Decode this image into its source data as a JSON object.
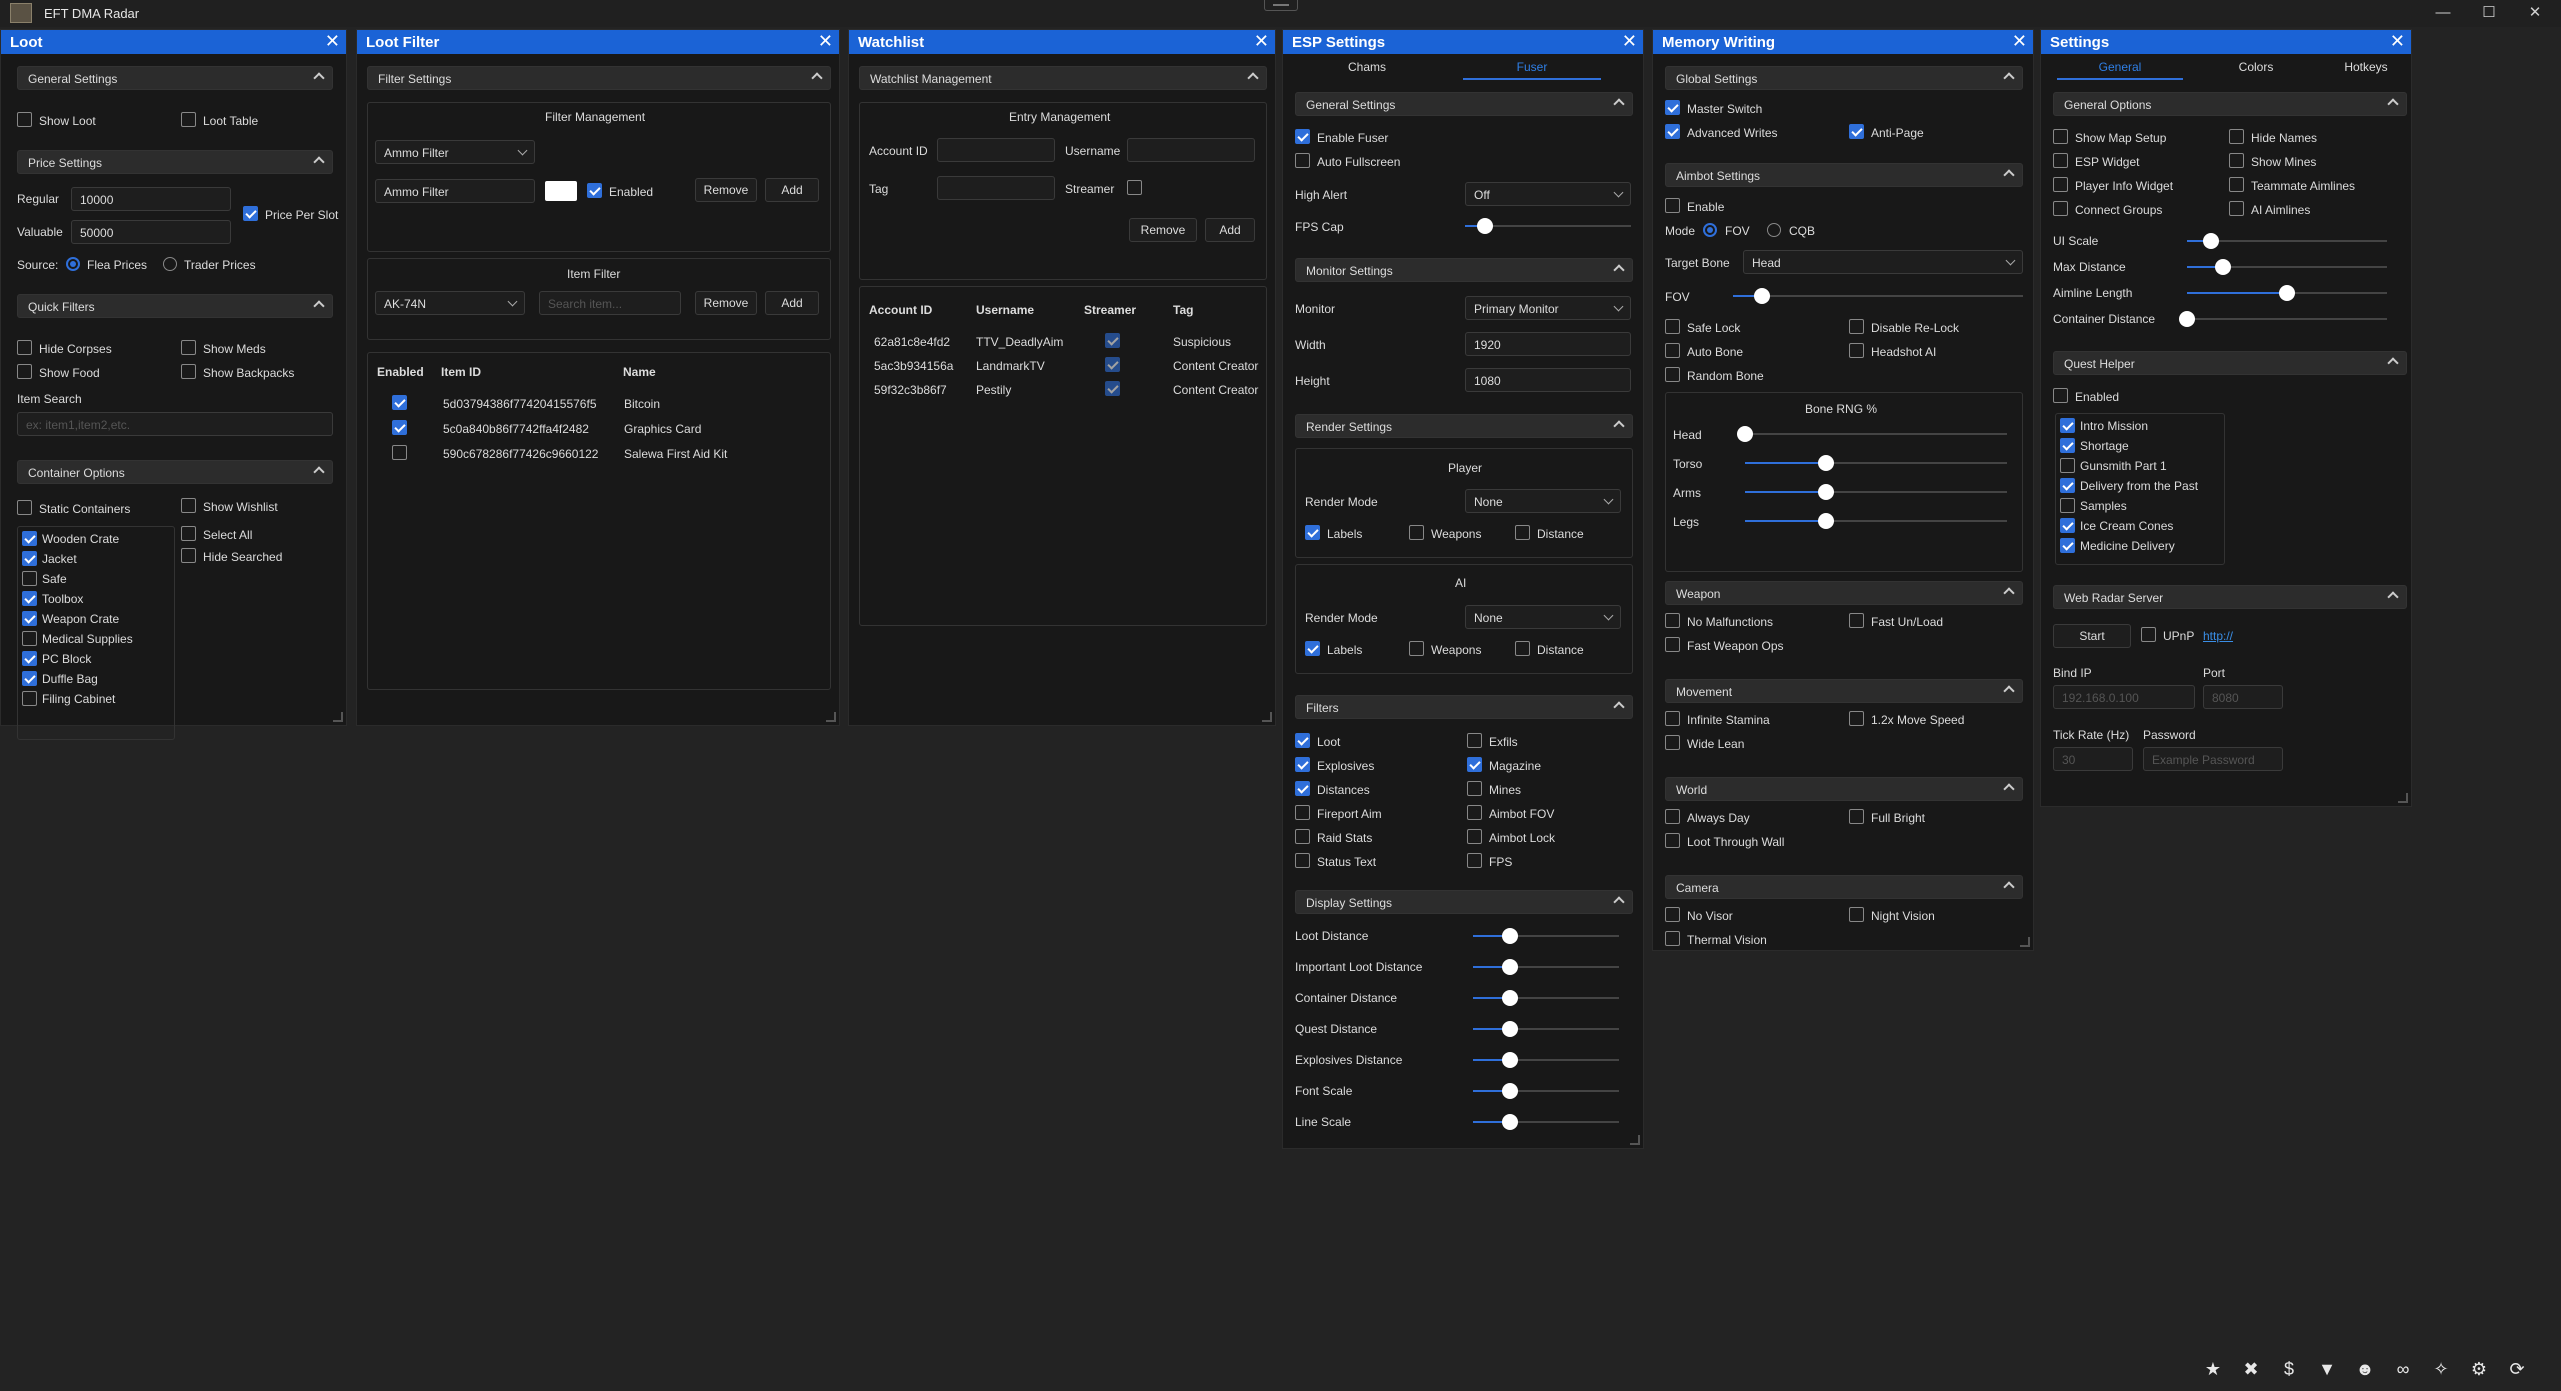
{
  "app": {
    "title": "EFT DMA Radar"
  },
  "loot": {
    "title": "Loot",
    "general_settings": "General Settings",
    "show_loot": "Show Loot",
    "loot_table": "Loot Table",
    "price_settings": "Price Settings",
    "regular_label": "Regular",
    "regular_value": "10000",
    "valuable_label": "Valuable",
    "valuable_value": "50000",
    "price_per_slot": "Price Per Slot",
    "source_label": "Source:",
    "flea": "Flea Prices",
    "trader": "Trader Prices",
    "quick_filters": "Quick Filters",
    "hide_corpses": "Hide Corpses",
    "show_meds": "Show Meds",
    "show_food": "Show Food",
    "show_backpacks": "Show Backpacks",
    "item_search": "Item Search",
    "item_search_ph": "ex: item1,item2,etc.",
    "container_options": "Container Options",
    "static_containers": "Static Containers",
    "show_wishlist": "Show Wishlist",
    "select_all": "Select All",
    "hide_searched": "Hide Searched",
    "containers": [
      {
        "label": "Wooden Crate",
        "checked": true
      },
      {
        "label": "Jacket",
        "checked": true
      },
      {
        "label": "Safe",
        "checked": false
      },
      {
        "label": "Toolbox",
        "checked": true
      },
      {
        "label": "Weapon Crate",
        "checked": true
      },
      {
        "label": "Medical Supplies",
        "checked": false
      },
      {
        "label": "PC Block",
        "checked": true
      },
      {
        "label": "Duffle Bag",
        "checked": true
      },
      {
        "label": "Filing Cabinet",
        "checked": false
      }
    ]
  },
  "loot_filter": {
    "title": "Loot Filter",
    "filter_settings": "Filter Settings",
    "filter_management": "Filter Management",
    "selected_filter": "Ammo Filter",
    "filter_name": "Ammo Filter",
    "enabled": "Enabled",
    "remove": "Remove",
    "add": "Add",
    "item_filter": "Item Filter",
    "item_selected": "AK-74N",
    "search_ph": "Search item...",
    "col_enabled": "Enabled",
    "col_item_id": "Item ID",
    "col_name": "Name",
    "rows": [
      {
        "id": "5d03794386f77420415576f5",
        "name": "Bitcoin",
        "enabled": true
      },
      {
        "id": "5c0a840b86f7742ffa4f2482",
        "name": "Graphics Card",
        "enabled": true
      },
      {
        "id": "590c678286f77426c9660122",
        "name": "Salewa First Aid Kit",
        "enabled": false
      }
    ]
  },
  "watchlist": {
    "title": "Watchlist",
    "management": "Watchlist Management",
    "entry_management": "Entry Management",
    "account_id": "Account ID",
    "username": "Username",
    "tag": "Tag",
    "streamer": "Streamer",
    "remove": "Remove",
    "add": "Add",
    "col_account": "Account ID",
    "col_username": "Username",
    "col_streamer": "Streamer",
    "col_tag": "Tag",
    "rows": [
      {
        "id": "62a81c8e4fd2",
        "user": "TTV_DeadlyAim",
        "tag": "Suspicious"
      },
      {
        "id": "5ac3b934156a",
        "user": "LandmarkTV",
        "tag": "Content Creator"
      },
      {
        "id": "59f32c3b86f7",
        "user": "Pestily",
        "tag": "Content Creator"
      }
    ]
  },
  "esp": {
    "title": "ESP Settings",
    "tab_chams": "Chams",
    "tab_fuser": "Fuser",
    "general_settings": "General Settings",
    "enable_fuser": "Enable Fuser",
    "auto_fullscreen": "Auto Fullscreen",
    "high_alert": "High Alert",
    "high_alert_value": "Off",
    "fps_cap": "FPS Cap",
    "fps_cap_level": 0.12,
    "monitor_settings": "Monitor Settings",
    "monitor": "Monitor",
    "monitor_value": "Primary Monitor",
    "width": "Width",
    "width_value": "1920",
    "height": "Height",
    "height_value": "1080",
    "render_settings": "Render Settings",
    "player": "Player",
    "ai": "AI",
    "render_mode": "Render Mode",
    "render_mode_value": "None",
    "labels": "Labels",
    "weapons": "Weapons",
    "distance": "Distance",
    "filters": "Filters",
    "filter_items": [
      {
        "label": "Loot",
        "checked": true
      },
      {
        "label": "Exfils",
        "checked": false
      },
      {
        "label": "Explosives",
        "checked": true
      },
      {
        "label": "Magazine",
        "checked": true
      },
      {
        "label": "Distances",
        "checked": true
      },
      {
        "label": "Mines",
        "checked": false
      },
      {
        "label": "Fireport Aim",
        "checked": false
      },
      {
        "label": "Aimbot FOV",
        "checked": false
      },
      {
        "label": "Raid Stats",
        "checked": false
      },
      {
        "label": "Aimbot Lock",
        "checked": false
      },
      {
        "label": "Status Text",
        "checked": false
      },
      {
        "label": "FPS",
        "checked": false
      }
    ],
    "display_settings": "Display Settings",
    "display_sliders": [
      {
        "label": "Loot Distance",
        "level": 0.25
      },
      {
        "label": "Important Loot Distance",
        "level": 0.25
      },
      {
        "label": "Container Distance",
        "level": 0.25
      },
      {
        "label": "Quest Distance",
        "level": 0.25
      },
      {
        "label": "Explosives Distance",
        "level": 0.25
      },
      {
        "label": "Font Scale",
        "level": 0.25
      },
      {
        "label": "Line Scale",
        "level": 0.25
      }
    ]
  },
  "memory": {
    "title": "Memory Writing",
    "global_settings": "Global Settings",
    "master_switch": "Master Switch",
    "advanced_writes": "Advanced Writes",
    "anti_page": "Anti-Page",
    "aimbot_settings": "Aimbot Settings",
    "enable": "Enable",
    "mode": "Mode",
    "fov": "FOV",
    "cqb": "CQB",
    "target_bone": "Target Bone",
    "target_bone_value": "Head",
    "fov_label": "FOV",
    "fov_level": 0.1,
    "safe_lock": "Safe Lock",
    "disable_relock": "Disable Re-Lock",
    "auto_bone": "Auto Bone",
    "headshot_ai": "Headshot AI",
    "random_bone": "Random Bone",
    "bone_rng": "Bone RNG %",
    "bones": [
      {
        "label": "Head",
        "level": 0.0
      },
      {
        "label": "Torso",
        "level": 0.31
      },
      {
        "label": "Arms",
        "level": 0.31
      },
      {
        "label": "Legs",
        "level": 0.31
      }
    ],
    "weapon": "Weapon",
    "no_malfunctions": "No Malfunctions",
    "fast_unload": "Fast Un/Load",
    "fast_weapon_ops": "Fast Weapon Ops",
    "movement": "Movement",
    "infinite_stamina": "Infinite Stamina",
    "move_speed": "1.2x Move Speed",
    "wide_lean": "Wide Lean",
    "world": "World",
    "always_day": "Always Day",
    "full_bright": "Full Bright",
    "loot_through_wall": "Loot Through Wall",
    "camera": "Camera",
    "no_visor": "No Visor",
    "night_vision": "Night Vision",
    "thermal_vision": "Thermal Vision"
  },
  "settings": {
    "title": "Settings",
    "tab_general": "General",
    "tab_colors": "Colors",
    "tab_hotkeys": "Hotkeys",
    "general_options": "General Options",
    "options": [
      {
        "label": "Show Map Setup",
        "checked": false
      },
      {
        "label": "Hide Names",
        "checked": false
      },
      {
        "label": "ESP Widget",
        "checked": false
      },
      {
        "label": "Show Mines",
        "checked": false
      },
      {
        "label": "Player Info Widget",
        "checked": false
      },
      {
        "label": "Teammate Aimlines",
        "checked": false
      },
      {
        "label": "Connect Groups",
        "checked": false
      },
      {
        "label": "AI Aimlines",
        "checked": false
      }
    ],
    "sliders": [
      {
        "label": "UI Scale",
        "level": 0.12
      },
      {
        "label": "Max Distance",
        "level": 0.18
      },
      {
        "label": "Aimline Length",
        "level": 0.5
      },
      {
        "label": "Container Distance",
        "level": 0.0
      }
    ],
    "quest_helper": "Quest Helper",
    "enabled": "Enabled",
    "quests": [
      {
        "label": "Intro Mission",
        "checked": true
      },
      {
        "label": "Shortage",
        "checked": true
      },
      {
        "label": "Gunsmith Part 1",
        "checked": false
      },
      {
        "label": "Delivery from the Past",
        "checked": true
      },
      {
        "label": "Samples",
        "checked": false
      },
      {
        "label": "Ice Cream Cones",
        "checked": true
      },
      {
        "label": "Medicine Delivery",
        "checked": true
      }
    ],
    "web_radar": "Web Radar Server",
    "start": "Start",
    "upnp": "UPnP",
    "link": "http://",
    "bind_ip": "Bind IP",
    "bind_ip_ph": "192.168.0.100",
    "port": "Port",
    "port_ph": "8080",
    "tick_rate": "Tick Rate (Hz)",
    "tick_ph": "30",
    "password": "Password",
    "password_ph": "Example Password"
  },
  "taskbar": {
    "icons": [
      "star-icon",
      "crosshair-icon",
      "dollar-icon",
      "filter-icon",
      "users-icon",
      "glasses-icon",
      "wand-icon",
      "gear-icon",
      "refresh-icon"
    ]
  },
  "colors": {
    "accent": "#2f6fda",
    "header": "#1b63d6",
    "background": "#232323",
    "panel": "#181818"
  }
}
